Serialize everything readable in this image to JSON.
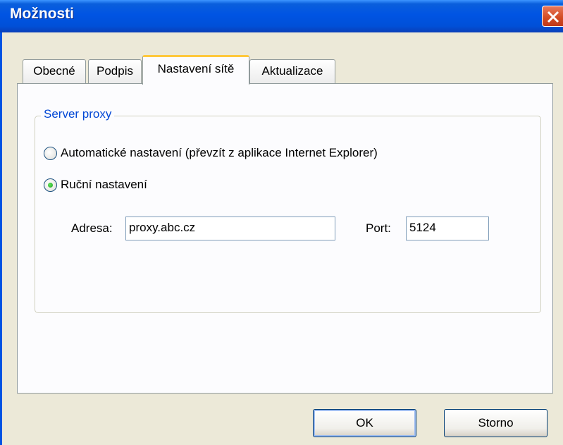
{
  "window": {
    "title": "Možnosti"
  },
  "tabs": [
    {
      "label": "Obecné"
    },
    {
      "label": "Podpis"
    },
    {
      "label": "Nastavení sítě"
    },
    {
      "label": "Aktualizace"
    }
  ],
  "proxy": {
    "group_title": "Server proxy",
    "option_auto": "Automatické nastavení (převzít z aplikace Internet Explorer)",
    "option_manual": "Ruční nastavení",
    "selected": "manual",
    "address_label": "Adresa:",
    "address_value": "proxy.abc.cz",
    "port_label": "Port:",
    "port_value": "5124"
  },
  "buttons": {
    "ok": "OK",
    "cancel": "Storno"
  }
}
